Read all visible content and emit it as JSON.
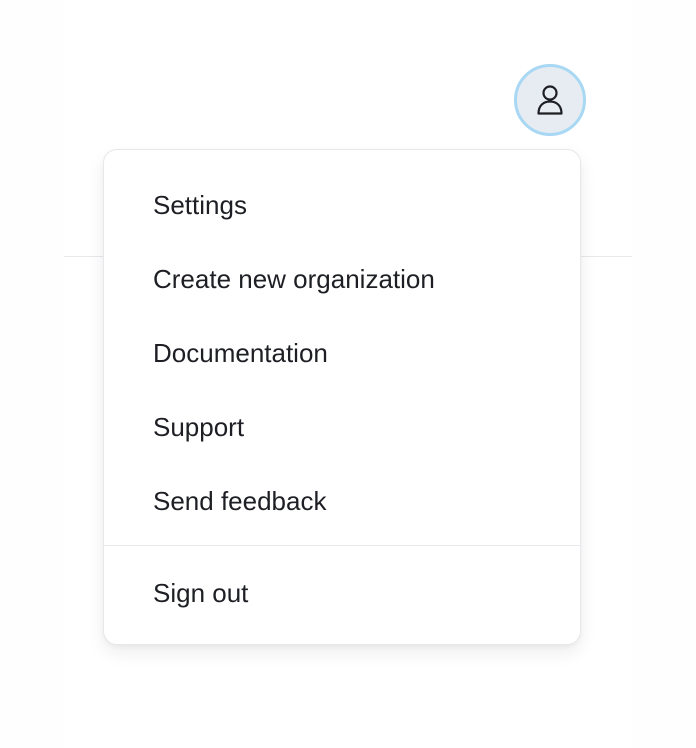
{
  "user_menu": {
    "avatar_icon": "user-icon",
    "colors": {
      "avatar_fill": "#e7ecf2",
      "avatar_ring": "#a8d8f4",
      "menu_text": "#1d1f24",
      "divider": "#e8e9ec"
    },
    "items": [
      {
        "label": "Settings"
      },
      {
        "label": "Create new organization"
      },
      {
        "label": "Documentation"
      },
      {
        "label": "Support"
      },
      {
        "label": "Send feedback"
      }
    ],
    "sign_out_label": "Sign out"
  }
}
